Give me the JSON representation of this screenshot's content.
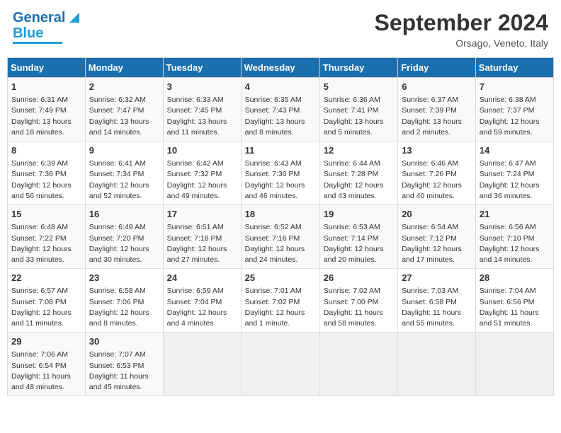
{
  "logo": {
    "line1": "General",
    "line2": "Blue"
  },
  "title": "September 2024",
  "location": "Orsago, Veneto, Italy",
  "headers": [
    "Sunday",
    "Monday",
    "Tuesday",
    "Wednesday",
    "Thursday",
    "Friday",
    "Saturday"
  ],
  "weeks": [
    [
      {
        "day": "1",
        "sunrise": "Sunrise: 6:31 AM",
        "sunset": "Sunset: 7:49 PM",
        "daylight": "Daylight: 13 hours and 18 minutes."
      },
      {
        "day": "2",
        "sunrise": "Sunrise: 6:32 AM",
        "sunset": "Sunset: 7:47 PM",
        "daylight": "Daylight: 13 hours and 14 minutes."
      },
      {
        "day": "3",
        "sunrise": "Sunrise: 6:33 AM",
        "sunset": "Sunset: 7:45 PM",
        "daylight": "Daylight: 13 hours and 11 minutes."
      },
      {
        "day": "4",
        "sunrise": "Sunrise: 6:35 AM",
        "sunset": "Sunset: 7:43 PM",
        "daylight": "Daylight: 13 hours and 8 minutes."
      },
      {
        "day": "5",
        "sunrise": "Sunrise: 6:36 AM",
        "sunset": "Sunset: 7:41 PM",
        "daylight": "Daylight: 13 hours and 5 minutes."
      },
      {
        "day": "6",
        "sunrise": "Sunrise: 6:37 AM",
        "sunset": "Sunset: 7:39 PM",
        "daylight": "Daylight: 13 hours and 2 minutes."
      },
      {
        "day": "7",
        "sunrise": "Sunrise: 6:38 AM",
        "sunset": "Sunset: 7:37 PM",
        "daylight": "Daylight: 12 hours and 59 minutes."
      }
    ],
    [
      {
        "day": "8",
        "sunrise": "Sunrise: 6:39 AM",
        "sunset": "Sunset: 7:36 PM",
        "daylight": "Daylight: 12 hours and 56 minutes."
      },
      {
        "day": "9",
        "sunrise": "Sunrise: 6:41 AM",
        "sunset": "Sunset: 7:34 PM",
        "daylight": "Daylight: 12 hours and 52 minutes."
      },
      {
        "day": "10",
        "sunrise": "Sunrise: 6:42 AM",
        "sunset": "Sunset: 7:32 PM",
        "daylight": "Daylight: 12 hours and 49 minutes."
      },
      {
        "day": "11",
        "sunrise": "Sunrise: 6:43 AM",
        "sunset": "Sunset: 7:30 PM",
        "daylight": "Daylight: 12 hours and 46 minutes."
      },
      {
        "day": "12",
        "sunrise": "Sunrise: 6:44 AM",
        "sunset": "Sunset: 7:28 PM",
        "daylight": "Daylight: 12 hours and 43 minutes."
      },
      {
        "day": "13",
        "sunrise": "Sunrise: 6:46 AM",
        "sunset": "Sunset: 7:26 PM",
        "daylight": "Daylight: 12 hours and 40 minutes."
      },
      {
        "day": "14",
        "sunrise": "Sunrise: 6:47 AM",
        "sunset": "Sunset: 7:24 PM",
        "daylight": "Daylight: 12 hours and 36 minutes."
      }
    ],
    [
      {
        "day": "15",
        "sunrise": "Sunrise: 6:48 AM",
        "sunset": "Sunset: 7:22 PM",
        "daylight": "Daylight: 12 hours and 33 minutes."
      },
      {
        "day": "16",
        "sunrise": "Sunrise: 6:49 AM",
        "sunset": "Sunset: 7:20 PM",
        "daylight": "Daylight: 12 hours and 30 minutes."
      },
      {
        "day": "17",
        "sunrise": "Sunrise: 6:51 AM",
        "sunset": "Sunset: 7:18 PM",
        "daylight": "Daylight: 12 hours and 27 minutes."
      },
      {
        "day": "18",
        "sunrise": "Sunrise: 6:52 AM",
        "sunset": "Sunset: 7:16 PM",
        "daylight": "Daylight: 12 hours and 24 minutes."
      },
      {
        "day": "19",
        "sunrise": "Sunrise: 6:53 AM",
        "sunset": "Sunset: 7:14 PM",
        "daylight": "Daylight: 12 hours and 20 minutes."
      },
      {
        "day": "20",
        "sunrise": "Sunrise: 6:54 AM",
        "sunset": "Sunset: 7:12 PM",
        "daylight": "Daylight: 12 hours and 17 minutes."
      },
      {
        "day": "21",
        "sunrise": "Sunrise: 6:56 AM",
        "sunset": "Sunset: 7:10 PM",
        "daylight": "Daylight: 12 hours and 14 minutes."
      }
    ],
    [
      {
        "day": "22",
        "sunrise": "Sunrise: 6:57 AM",
        "sunset": "Sunset: 7:08 PM",
        "daylight": "Daylight: 12 hours and 11 minutes."
      },
      {
        "day": "23",
        "sunrise": "Sunrise: 6:58 AM",
        "sunset": "Sunset: 7:06 PM",
        "daylight": "Daylight: 12 hours and 8 minutes."
      },
      {
        "day": "24",
        "sunrise": "Sunrise: 6:59 AM",
        "sunset": "Sunset: 7:04 PM",
        "daylight": "Daylight: 12 hours and 4 minutes."
      },
      {
        "day": "25",
        "sunrise": "Sunrise: 7:01 AM",
        "sunset": "Sunset: 7:02 PM",
        "daylight": "Daylight: 12 hours and 1 minute."
      },
      {
        "day": "26",
        "sunrise": "Sunrise: 7:02 AM",
        "sunset": "Sunset: 7:00 PM",
        "daylight": "Daylight: 11 hours and 58 minutes."
      },
      {
        "day": "27",
        "sunrise": "Sunrise: 7:03 AM",
        "sunset": "Sunset: 6:58 PM",
        "daylight": "Daylight: 11 hours and 55 minutes."
      },
      {
        "day": "28",
        "sunrise": "Sunrise: 7:04 AM",
        "sunset": "Sunset: 6:56 PM",
        "daylight": "Daylight: 11 hours and 51 minutes."
      }
    ],
    [
      {
        "day": "29",
        "sunrise": "Sunrise: 7:06 AM",
        "sunset": "Sunset: 6:54 PM",
        "daylight": "Daylight: 11 hours and 48 minutes."
      },
      {
        "day": "30",
        "sunrise": "Sunrise: 7:07 AM",
        "sunset": "Sunset: 6:53 PM",
        "daylight": "Daylight: 11 hours and 45 minutes."
      },
      null,
      null,
      null,
      null,
      null
    ]
  ]
}
